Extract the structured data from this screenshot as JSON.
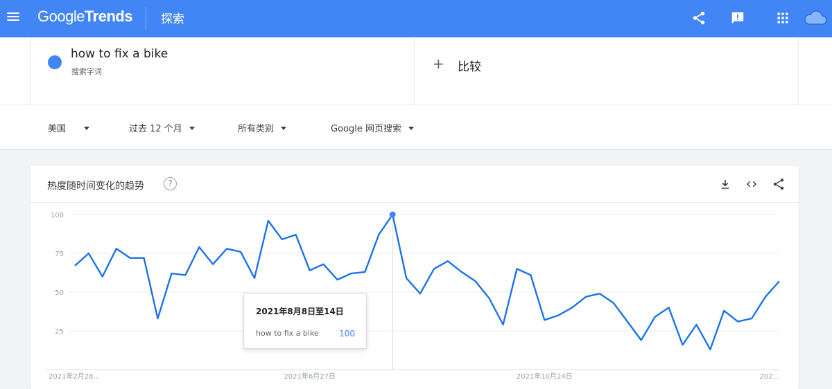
{
  "header": {
    "logo_google": "Google",
    "logo_trends": "Trends",
    "title": "探索",
    "icons": [
      "menu-icon",
      "share-icon",
      "feedback-icon",
      "apps-icon",
      "account-icon"
    ],
    "brand_color": "#4285f4"
  },
  "search": {
    "term": "how to fix a bike",
    "term_type": "搜索字词",
    "term_color": "#4285f4",
    "compare_label": "比较",
    "compare_icon": "plus-icon"
  },
  "filters": {
    "region": "美国",
    "time_range": "过去 12 个月",
    "category": "所有类别",
    "search_type": "Google 网页搜索"
  },
  "card": {
    "title": "热度随时间变化的趋势",
    "help": "?",
    "actions": [
      "download-icon",
      "embed-icon",
      "share-icon"
    ]
  },
  "tooltip": {
    "date": "2021年8月8日至14日",
    "term": "how to fix a bike",
    "value": "100"
  },
  "chart_data": {
    "type": "line",
    "title": "",
    "xlabel": "",
    "ylabel": "",
    "ylim": [
      0,
      100
    ],
    "yticks": [
      "100",
      "75",
      "50",
      "25"
    ],
    "ytick_values": [
      100,
      75,
      50,
      25
    ],
    "xticks": [
      "2021年2月28...",
      "2021年6月27日",
      "2021年10月24日",
      "202..."
    ],
    "xtick_indices": [
      0,
      17,
      34,
      51
    ],
    "grid": true,
    "legend": "none",
    "highlight_index": 23,
    "series": [
      {
        "color": "#1a73e8",
        "values": [
          67,
          75,
          60,
          78,
          72,
          72,
          33,
          62,
          61,
          79,
          68,
          78,
          76,
          59,
          96,
          84,
          87,
          64,
          68,
          58,
          62,
          63,
          87,
          100,
          59,
          49,
          65,
          70,
          63,
          57,
          46,
          29,
          65,
          61,
          32,
          35,
          40,
          47,
          49,
          43,
          31,
          19,
          34,
          40,
          16,
          29,
          13,
          38,
          31,
          33,
          47,
          57
        ]
      }
    ]
  }
}
